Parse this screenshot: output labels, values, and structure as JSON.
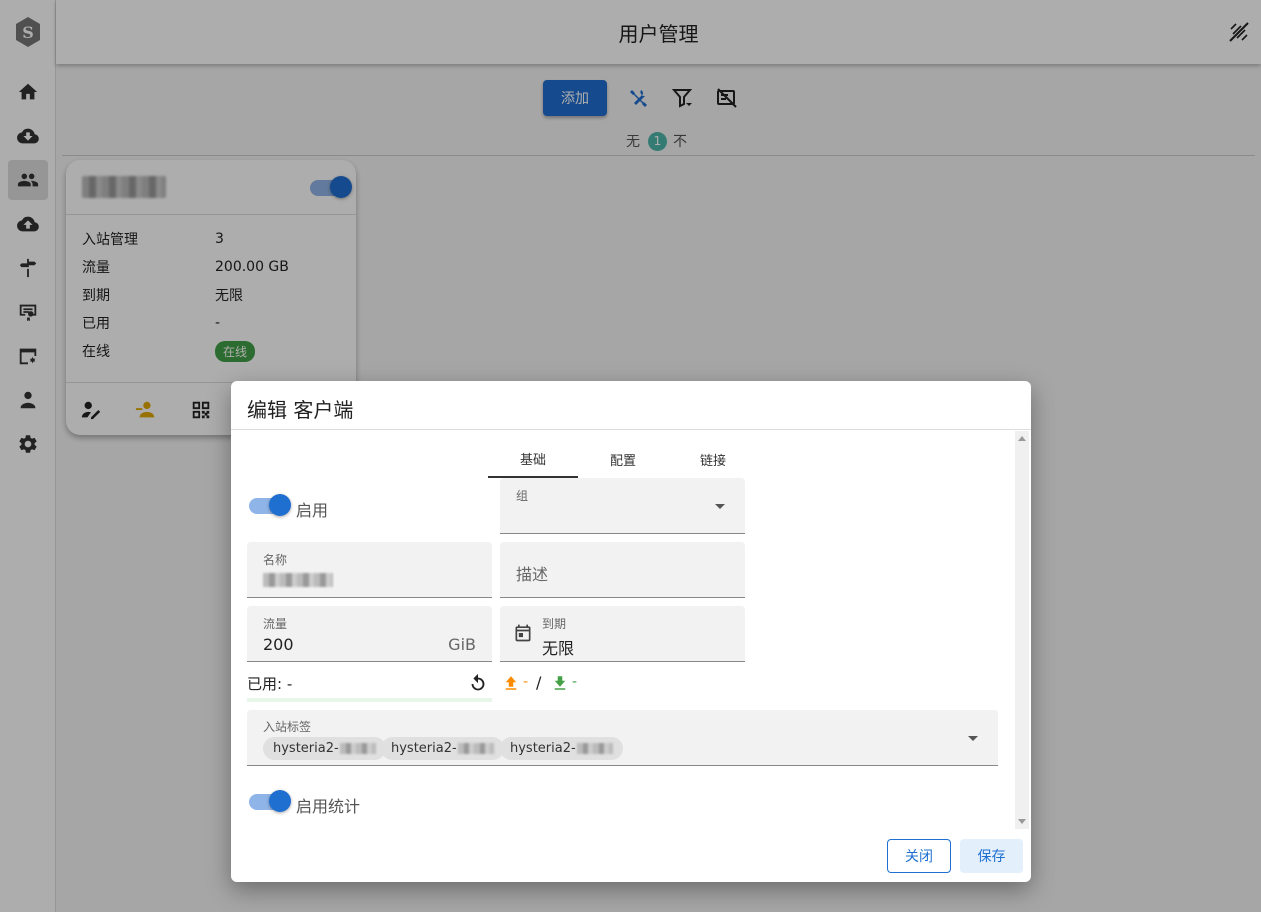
{
  "header": {
    "title": "用户管理"
  },
  "sidebar": {
    "items": [
      {
        "icon": "home-icon"
      },
      {
        "icon": "inbound-icon"
      },
      {
        "icon": "users-icon",
        "active": true
      },
      {
        "icon": "outbound-icon"
      },
      {
        "icon": "routing-icon"
      },
      {
        "icon": "certificate-icon"
      },
      {
        "icon": "services-icon"
      },
      {
        "icon": "admin-icon"
      },
      {
        "icon": "settings-icon"
      }
    ]
  },
  "toolbar": {
    "add_label": "添加"
  },
  "stats": {
    "prefix": "无",
    "count": "1",
    "suffix": "不"
  },
  "card": {
    "rows": [
      {
        "key": "入站管理",
        "value": "3"
      },
      {
        "key": "流量",
        "value": "200.00 GB"
      },
      {
        "key": "到期",
        "value": "无限"
      },
      {
        "key": "已用",
        "value": "-"
      },
      {
        "key": "在线",
        "value": "在线"
      }
    ]
  },
  "dialog": {
    "title": "编辑 客户端",
    "tabs": [
      "基础",
      "配置",
      "链接"
    ],
    "enable_label": "启用",
    "group_label": "组",
    "name_label": "名称",
    "desc_placeholder": "描述",
    "traffic_label": "流量",
    "traffic_value": "200",
    "traffic_unit": "GiB",
    "expiry_label": "到期",
    "expiry_value": "无限",
    "used_label": "已用: -",
    "up_value": "-",
    "separator": "/",
    "down_value": "-",
    "inbound_tags_label": "入站标签",
    "inbound_tags": [
      "hysteria2-",
      "hysteria2-",
      "hysteria2-"
    ],
    "stats_label": "启用统计",
    "close_label": "关闭",
    "save_label": "保存"
  },
  "colors": {
    "primary": "#1f6fd1",
    "online": "#43a047",
    "upload": "#fb8c00",
    "download": "#43a047"
  }
}
